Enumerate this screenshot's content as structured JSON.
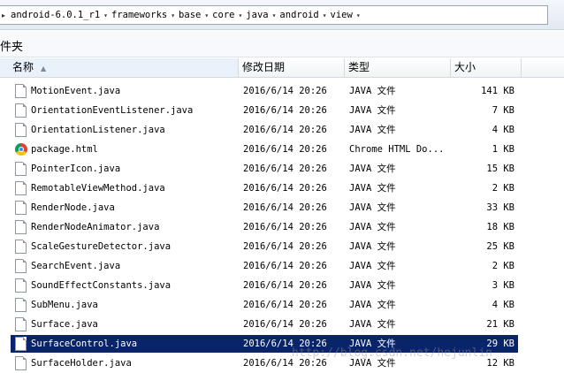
{
  "address": {
    "crumbs": [
      "android-6.0.1_r1",
      "frameworks",
      "base",
      "core",
      "java",
      "android",
      "view"
    ]
  },
  "folder_label": "件夹",
  "columns": {
    "name": "名称",
    "date": "修改日期",
    "type": "类型",
    "size": "大小"
  },
  "files": [
    {
      "name": "MotionEvent.java",
      "date": "2016/6/14 20:26",
      "type": "JAVA 文件",
      "size": "141 KB",
      "icon": "file"
    },
    {
      "name": "OrientationEventListener.java",
      "date": "2016/6/14 20:26",
      "type": "JAVA 文件",
      "size": "7 KB",
      "icon": "file"
    },
    {
      "name": "OrientationListener.java",
      "date": "2016/6/14 20:26",
      "type": "JAVA 文件",
      "size": "4 KB",
      "icon": "file"
    },
    {
      "name": "package.html",
      "date": "2016/6/14 20:26",
      "type": "Chrome HTML Do...",
      "size": "1 KB",
      "icon": "chrome"
    },
    {
      "name": "PointerIcon.java",
      "date": "2016/6/14 20:26",
      "type": "JAVA 文件",
      "size": "15 KB",
      "icon": "file"
    },
    {
      "name": "RemotableViewMethod.java",
      "date": "2016/6/14 20:26",
      "type": "JAVA 文件",
      "size": "2 KB",
      "icon": "file"
    },
    {
      "name": "RenderNode.java",
      "date": "2016/6/14 20:26",
      "type": "JAVA 文件",
      "size": "33 KB",
      "icon": "file"
    },
    {
      "name": "RenderNodeAnimator.java",
      "date": "2016/6/14 20:26",
      "type": "JAVA 文件",
      "size": "18 KB",
      "icon": "file"
    },
    {
      "name": "ScaleGestureDetector.java",
      "date": "2016/6/14 20:26",
      "type": "JAVA 文件",
      "size": "25 KB",
      "icon": "file"
    },
    {
      "name": "SearchEvent.java",
      "date": "2016/6/14 20:26",
      "type": "JAVA 文件",
      "size": "2 KB",
      "icon": "file"
    },
    {
      "name": "SoundEffectConstants.java",
      "date": "2016/6/14 20:26",
      "type": "JAVA 文件",
      "size": "3 KB",
      "icon": "file"
    },
    {
      "name": "SubMenu.java",
      "date": "2016/6/14 20:26",
      "type": "JAVA 文件",
      "size": "4 KB",
      "icon": "file"
    },
    {
      "name": "Surface.java",
      "date": "2016/6/14 20:26",
      "type": "JAVA 文件",
      "size": "21 KB",
      "icon": "file"
    },
    {
      "name": "SurfaceControl.java",
      "date": "2016/6/14 20:26",
      "type": "JAVA 文件",
      "size": "29 KB",
      "icon": "file",
      "selected": true
    },
    {
      "name": "SurfaceHolder.java",
      "date": "2016/6/14 20:26",
      "type": "JAVA 文件",
      "size": "12 KB",
      "icon": "file"
    }
  ],
  "watermark": "http://blog.csdn.net/hejunlin",
  "colors": {
    "selection": "#0a246a",
    "header_active": "#e9f2fb"
  }
}
